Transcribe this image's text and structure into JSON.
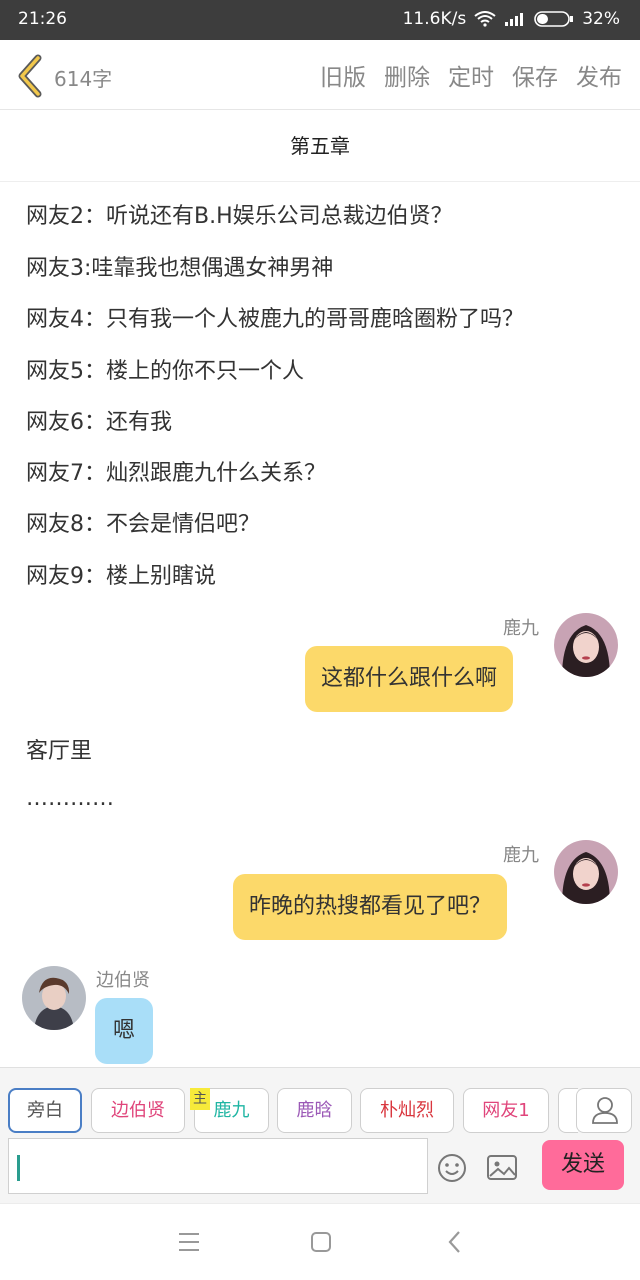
{
  "status_bar": {
    "time": "21:26",
    "speed": "11.6K/s",
    "battery": "32%",
    "icons": [
      "wifi-icon",
      "signal-icon",
      "battery-icon"
    ]
  },
  "header": {
    "back_icon": "back-chevron-icon",
    "word_count": "614字",
    "actions": [
      "旧版",
      "删除",
      "定时",
      "保存",
      "发布"
    ]
  },
  "chapter": {
    "title": "第五章"
  },
  "narration": [
    "网友2：听说还有B.H娱乐公司总裁边伯贤？",
    "网友3:哇靠我也想偶遇女神男神",
    "网友4：只有我一个人被鹿九的哥哥鹿晗圈粉了吗？",
    "网友5：楼上的你不只一个人",
    "网友6：还有我",
    "网友7：灿烈跟鹿九什么关系？",
    "网友8：不会是情侣吧？",
    "网友9：楼上别瞎说"
  ],
  "messages": [
    {
      "speaker": "鹿九",
      "text": "这都什么跟什么啊"
    },
    {
      "speaker": "鹿九",
      "text": "昨晚的热搜都看见了吧？"
    },
    {
      "speaker": "边伯贤",
      "text": "嗯"
    }
  ],
  "narration2": [
    "客厅里",
    "…………"
  ],
  "composer": {
    "roles": [
      "旁白",
      "边伯贤",
      "鹿九",
      "鹿晗",
      "朴灿烈",
      "网友1"
    ],
    "main_tag": "主",
    "send_label": "发送",
    "icons": [
      "person-icon",
      "emoji-icon",
      "image-icon"
    ]
  },
  "colors": {
    "accent_yellow": "#fcd96a",
    "accent_blue": "#a9def8",
    "send_pink": "#ff6b9a",
    "role_pink": "#e0457b",
    "role_teal": "#1fb5a3",
    "role_purple": "#9b59b6",
    "role_red": "#d9363e"
  },
  "nav_icons": [
    "menu-icon",
    "home-icon",
    "back-icon"
  ]
}
